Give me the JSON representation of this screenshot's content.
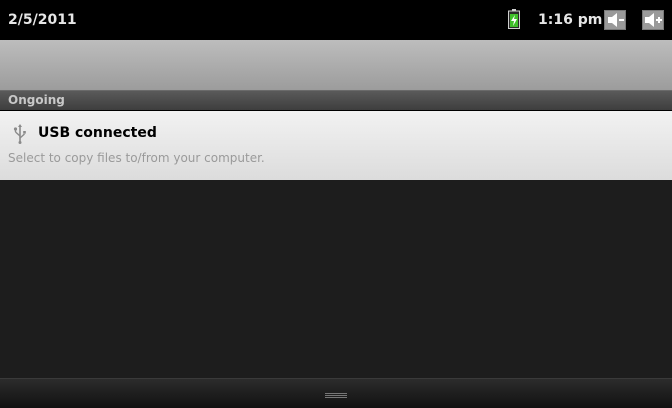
{
  "status_bar": {
    "date": "2/5/2011",
    "time": "1:16 pm",
    "icons": [
      "battery-charging-icon",
      "notification-speaker-icon",
      "notification-speaker-plus-icon"
    ]
  },
  "section": {
    "label": "Ongoing"
  },
  "notification": {
    "icon": "usb-icon",
    "title": "USB connected",
    "text": "Select to copy files to/from your computer."
  },
  "colors": {
    "battery_green": "#3fbf2a",
    "status_bar_bg": "#000000",
    "panel_bg": "#1d1d1d",
    "notification_bg": "#e8e8e8"
  }
}
